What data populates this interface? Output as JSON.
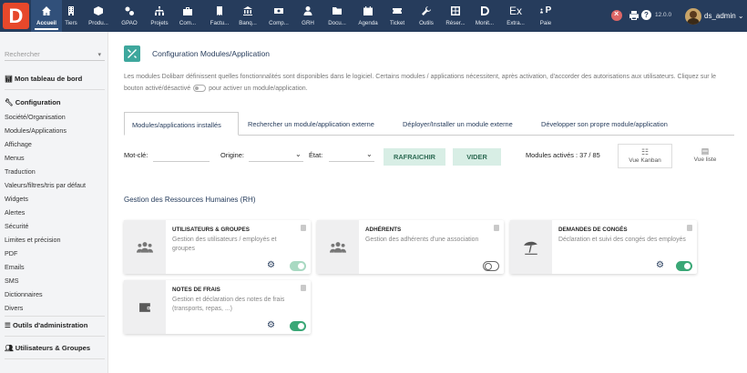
{
  "app": {
    "logo_letter": "D",
    "user": "ds_admin",
    "version": "12.0.0"
  },
  "topmenu": [
    {
      "label": "Accueil",
      "icon": "home-icon",
      "active": true
    },
    {
      "label": "Tiers",
      "icon": "building-icon"
    },
    {
      "label": "Produ...",
      "icon": "cube-icon"
    },
    {
      "label": "GPAO",
      "icon": "cogs-icon"
    },
    {
      "label": "Projets",
      "icon": "sitemap-icon"
    },
    {
      "label": "Com...",
      "icon": "suitcase-icon"
    },
    {
      "label": "Factu...",
      "icon": "invoice-icon"
    },
    {
      "label": "Banq...",
      "icon": "bank-icon"
    },
    {
      "label": "Comp...",
      "icon": "money-icon"
    },
    {
      "label": "GRH",
      "icon": "user-tie-icon"
    },
    {
      "label": "Docu...",
      "icon": "folder-icon"
    },
    {
      "label": "Agenda",
      "icon": "calendar-icon"
    },
    {
      "label": "Ticket",
      "icon": "ticket-icon"
    },
    {
      "label": "Outils",
      "icon": "wrench-icon"
    },
    {
      "label": "Réser...",
      "icon": "grid-icon"
    },
    {
      "label": "Monit...",
      "icon": "monitor-d-icon"
    },
    {
      "label": "Extra...",
      "icon": "ex-icon",
      "glyph": "Ex"
    },
    {
      "label": "Paie",
      "icon": "paie-icon",
      "glyph": "P"
    }
  ],
  "sidebar": {
    "search_placeholder": "Rechercher",
    "dashboard": "Mon tableau de bord",
    "config_header": "Configuration",
    "items": [
      "Société/Organisation",
      "Modules/Applications",
      "Affichage",
      "Menus",
      "Traduction",
      "Valeurs/filtres/tris par défaut",
      "Widgets",
      "Alertes",
      "Sécurité",
      "Limites et précision",
      "PDF",
      "Emails",
      "SMS",
      "Dictionnaires",
      "Divers"
    ],
    "admin_tools": "Outils d'administration",
    "users_groups": "Utilisateurs & Groupes"
  },
  "main": {
    "title": "Configuration Modules/Application",
    "description_part1": "Les modules Dolibarr définissent quelles fonctionnalités sont disponibles dans le logiciel. Certains modules / applications nécessitent, après activation, d'accorder des autorisations aux utilisateurs. Cliquez sur le bouton activé/désactivé",
    "description_part2": "pour activer un module/application.",
    "tabs": [
      "Modules/applications installés",
      "Rechercher un module/application externe",
      "Déployer/Installer un module externe",
      "Développer son propre module/application"
    ],
    "filters": {
      "keyword_label": "Mot-clé:",
      "origin_label": "Origine:",
      "state_label": "État:",
      "refresh_button": "RAFRAICHIR",
      "clear_button": "VIDER",
      "active_modules": "Modules activés : 37 / 85",
      "kanban_view": "Vue Kanban",
      "list_view": "Vue liste"
    },
    "section_title": "Gestion des Ressources Humaines (RH)",
    "modules": [
      {
        "title": "UTILISATEURS & GROUPES",
        "desc": "Gestion des utilisateurs / employés et groupes",
        "icon": "users-icon",
        "settings": true,
        "state": "on-light"
      },
      {
        "title": "ADHÉRENTS",
        "desc": "Gestion des adhérents d'une association",
        "icon": "users-icon",
        "settings": false,
        "state": "off"
      },
      {
        "title": "DEMANDES DE CONGÉS",
        "desc": "Déclaration et suivi des congés des employés",
        "icon": "beach-icon",
        "settings": true,
        "state": "on"
      },
      {
        "title": "NOTES DE FRAIS",
        "desc": "Gestion et déclaration des notes de frais (transports, repas, ...)",
        "icon": "wallet-icon",
        "settings": true,
        "state": "on"
      }
    ]
  },
  "colors": {
    "topbar": "#263c5c",
    "accent": "#3ea79d",
    "toggle_on": "#3aa776",
    "logo": "#e6482b"
  }
}
